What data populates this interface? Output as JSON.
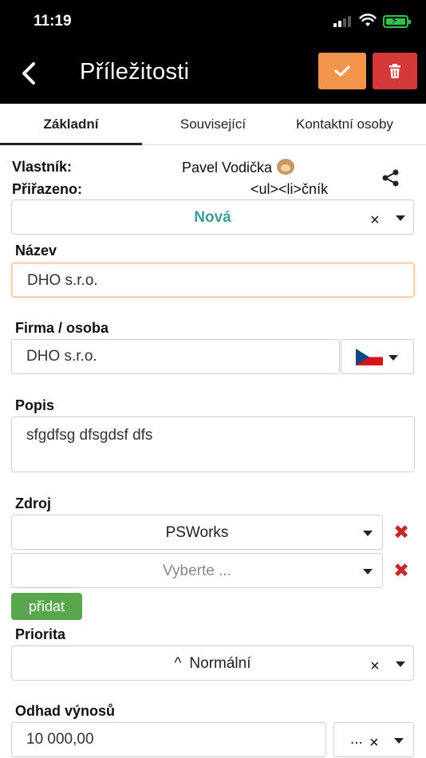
{
  "status_bar": {
    "time": "11:19"
  },
  "header": {
    "title": "Příležitosti"
  },
  "tabs": [
    {
      "label": "Základní"
    },
    {
      "label": "Související"
    },
    {
      "label": "Kontaktní osoby"
    }
  ],
  "owner": {
    "owner_label": "Vlastník:",
    "owner_value": "Pavel Vodička",
    "assigned_label": "Přiřazeno:",
    "assigned_value": "<ul><li>čník"
  },
  "status_select": {
    "value": "Nová",
    "color": "#3a9e96"
  },
  "name_field": {
    "label": "Název",
    "value": "DHO s.r.o."
  },
  "company_field": {
    "label": "Firma / osoba",
    "value": "DHO s.r.o.",
    "flag": "czech-flag-icon"
  },
  "description_field": {
    "label": "Popis",
    "value": "sfgdfsg dfsgdsf dfs"
  },
  "source": {
    "label": "Zdroj",
    "items": [
      {
        "value": "PSWorks"
      },
      {
        "value": "Vyberte ..."
      }
    ],
    "add_label": "přidat"
  },
  "priority": {
    "label": "Priorita",
    "value": "Normální",
    "arrow": "^"
  },
  "revenue": {
    "label": "Odhad výnosů",
    "value": "10 000,00",
    "currency_value": "..."
  },
  "colors": {
    "confirm": "#f0954a",
    "delete": "#d43a3a",
    "add": "#5aa64e",
    "remove": "#c62828"
  }
}
